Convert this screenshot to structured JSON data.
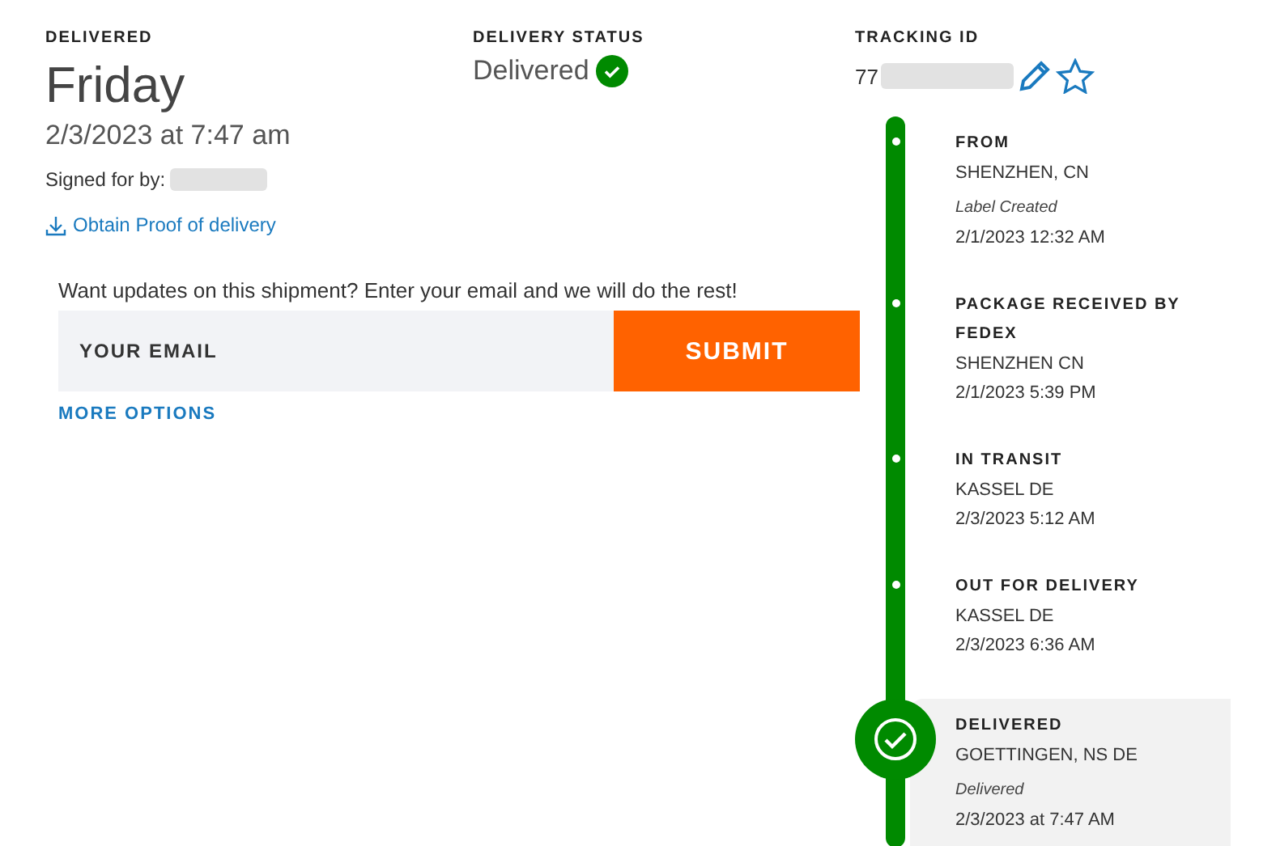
{
  "delivered": {
    "heading": "DELIVERED",
    "day": "Friday",
    "datetime": "2/3/2023 at 7:47 am",
    "signed_label": "Signed for by:",
    "proof_link": "Obtain Proof of delivery"
  },
  "status": {
    "heading": "DELIVERY STATUS",
    "value": "Delivered"
  },
  "tracking": {
    "heading": "TRACKING ID",
    "id_prefix": "77"
  },
  "updates": {
    "prompt": "Want updates on this shipment? Enter your email and we will do the rest!",
    "email_placeholder": "YOUR EMAIL",
    "submit": "SUBMIT",
    "more_options": "MORE OPTIONS"
  },
  "events": [
    {
      "kind": "step",
      "label": "FROM",
      "location": "SHENZHEN, CN",
      "note": "Label Created",
      "time": "2/1/2023 12:32 AM"
    },
    {
      "kind": "step",
      "label": "PACKAGE RECEIVED BY FEDEX",
      "location": "SHENZHEN CN",
      "time": "2/1/2023 5:39 PM"
    },
    {
      "kind": "step",
      "label": "IN TRANSIT",
      "location": "KASSEL DE",
      "time": "2/3/2023 5:12 AM"
    },
    {
      "kind": "step",
      "label": "OUT FOR DELIVERY",
      "location": "KASSEL DE",
      "time": "2/3/2023 6:36 AM"
    },
    {
      "kind": "current",
      "label": "DELIVERED",
      "location": "GOETTINGEN, NS DE",
      "note": "Delivered",
      "time": "2/3/2023 at 7:47 AM"
    }
  ]
}
